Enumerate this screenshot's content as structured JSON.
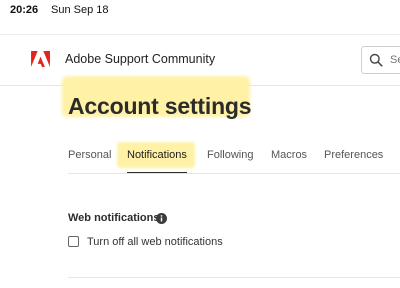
{
  "status_bar": {
    "time": "20:26",
    "date": "Sun Sep 18"
  },
  "header": {
    "brand": "Adobe Support Community",
    "logo_color": "#e1251b",
    "search_placeholder": "Se"
  },
  "page": {
    "title": "Account settings",
    "highlight_color": "#fff2a6"
  },
  "tabs": [
    {
      "label": "Personal",
      "active": false
    },
    {
      "label": "Notifications",
      "active": true
    },
    {
      "label": "Following",
      "active": false
    },
    {
      "label": "Macros",
      "active": false
    },
    {
      "label": "Preferences",
      "active": false
    }
  ],
  "web_notifications": {
    "title": "Web notifications",
    "info_icon": "info-icon",
    "option_label": "Turn off all web notifications",
    "option_checked": false
  }
}
